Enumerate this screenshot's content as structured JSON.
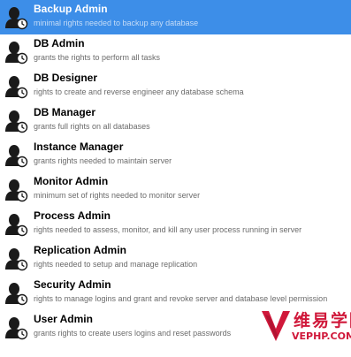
{
  "roles": [
    {
      "title": "Backup Admin",
      "description": "minimal rights needed to backup any database",
      "selected": true
    },
    {
      "title": "DB Admin",
      "description": "grants the rights to perform all tasks",
      "selected": false
    },
    {
      "title": "DB Designer",
      "description": "rights to create and reverse engineer any database schema",
      "selected": false
    },
    {
      "title": "DB Manager",
      "description": "grants full rights on all databases",
      "selected": false
    },
    {
      "title": "Instance Manager",
      "description": "grants rights needed to maintain server",
      "selected": false
    },
    {
      "title": "Monitor Admin",
      "description": "minimum set of rights needed to monitor server",
      "selected": false
    },
    {
      "title": "Process Admin",
      "description": "rights needed to assess, monitor, and kill any user process running in server",
      "selected": false
    },
    {
      "title": "Replication Admin",
      "description": "rights needed to setup and manage replication",
      "selected": false
    },
    {
      "title": "Security Admin",
      "description": "rights to manage logins and grant and revoke server and database level permission",
      "selected": false
    },
    {
      "title": "User Admin",
      "description": "grants rights to create users logins and reset passwords",
      "selected": false
    }
  ],
  "watermark": {
    "chinese": "维易学院",
    "domain": "VEPHP.COM"
  },
  "colors": {
    "selected_background": "#3d8ee8",
    "watermark": "#d0183a"
  },
  "icons": {
    "role": "user-role-icon"
  }
}
